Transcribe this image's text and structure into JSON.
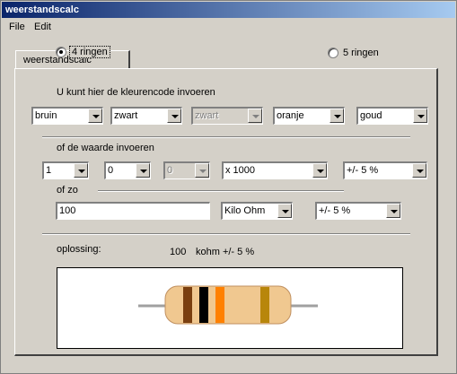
{
  "window": {
    "title": "weerstandscalc"
  },
  "menu": {
    "file": "File",
    "edit": "Edit"
  },
  "tab": {
    "label": "weerstandscalc"
  },
  "rings": {
    "option4": "4 ringen",
    "option5": "5 ringen",
    "selected": "4 ringen"
  },
  "colorcode": {
    "heading": "U kunt hier de kleurencode invoeren",
    "band1": "bruin",
    "band2": "zwart",
    "band3": "zwart",
    "multiplier": "oranje",
    "tolerance": "goud"
  },
  "value": {
    "heading": "of de waarde invoeren",
    "digit1": "1",
    "digit2": "0",
    "digit3": "0",
    "multiplier": "x 1000",
    "tolerance": "+/- 5 %"
  },
  "direct": {
    "heading": "of zo",
    "input": "100",
    "unit": "Kilo Ohm",
    "tolerance": "+/- 5 %"
  },
  "result": {
    "label": "oplossing:",
    "value": "100",
    "unit_tolerance": "kohm +/- 5 %"
  },
  "resistor": {
    "body_color": "#f0c890",
    "lead_color": "#a0a0a0",
    "bands": [
      {
        "name": "bruin",
        "color": "#7a3f10"
      },
      {
        "name": "zwart",
        "color": "#000000"
      },
      {
        "name": "oranje",
        "color": "#ff8000"
      },
      {
        "name": "goud",
        "color": "#b8860b"
      }
    ]
  }
}
